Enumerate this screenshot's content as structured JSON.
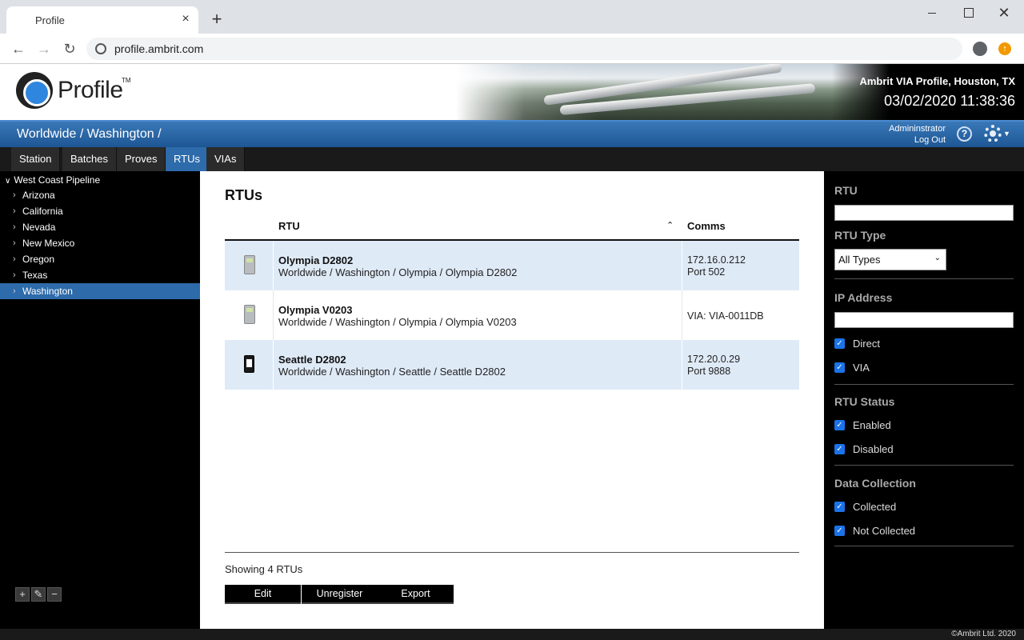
{
  "browser": {
    "tab_title": "Profile",
    "url": "profile.ambrit.com"
  },
  "header": {
    "logo_text": "Profile",
    "logo_tm": "TM",
    "site_title": "Ambrit VIA Profile, Houston, TX",
    "clock": "03/02/2020 11:38:36"
  },
  "breadcrumb": "Worldwide / Washington /",
  "user": {
    "name": "Admininstrator",
    "logout_label": "Log Out"
  },
  "tabs": [
    {
      "label": "Station",
      "active": false
    },
    {
      "label": "Batches",
      "active": false
    },
    {
      "label": "Proves",
      "active": false
    },
    {
      "label": "RTUs",
      "active": true
    },
    {
      "label": "VIAs",
      "active": false
    }
  ],
  "tree": {
    "root": "West Coast Pipeline",
    "items": [
      "Arizona",
      "California",
      "Nevada",
      "New Mexico",
      "Oregon",
      "Texas",
      "Washington"
    ],
    "selected": "Washington"
  },
  "main": {
    "title": "RTUs",
    "columns": {
      "rtu": "RTU",
      "comms": "Comms"
    },
    "rows": [
      {
        "name": "Olympia D2802",
        "path": "Worldwide / Washington / Olympia / Olympia D2802",
        "comms1": "172.16.0.212",
        "comms2": "Port 502",
        "icon": "rtu-device-icon"
      },
      {
        "name": "Olympia V0203",
        "path": "Worldwide / Washington / Olympia / Olympia V0203",
        "comms1": "VIA: VIA-0011DB",
        "comms2": "",
        "icon": "rtu-device-icon"
      },
      {
        "name": "Seattle D2802",
        "path": "Worldwide / Washington / Seattle / Seattle D2802",
        "comms1": "172.20.0.29",
        "comms2": "Port 9888",
        "icon": "phone-device-icon"
      }
    ],
    "showing": "Showing 4 RTUs",
    "buttons": {
      "edit": "Edit",
      "unregister": "Unregister",
      "export": "Export"
    }
  },
  "filters": {
    "rtu_label": "RTU",
    "rtu_value": "",
    "rtu_type_label": "RTU Type",
    "rtu_type_value": "All Types",
    "ip_label": "IP Address",
    "ip_value": "",
    "direct_label": "Direct",
    "via_label": "VIA",
    "status_label": "RTU Status",
    "enabled_label": "Enabled",
    "disabled_label": "Disabled",
    "collection_label": "Data Collection",
    "collected_label": "Collected",
    "not_collected_label": "Not Collected"
  },
  "footer": {
    "copyright": "©Ambrit Ltd. 2020"
  },
  "colors": {
    "accent": "#2d6bab",
    "row_highlight": "#dfeaf7",
    "checkbox": "#1a73e8"
  }
}
